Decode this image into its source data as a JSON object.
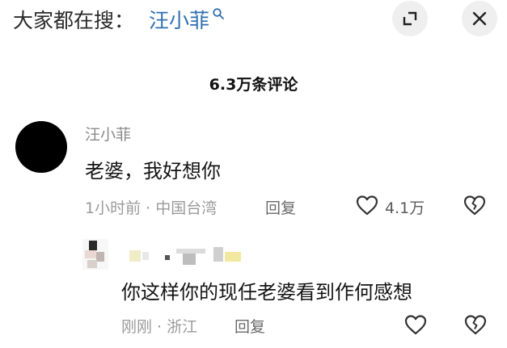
{
  "search": {
    "prefix": "大家都在搜：",
    "term": "汪小菲",
    "icon": "search-icon",
    "accent_color": "#2e6fb0"
  },
  "header": {
    "expand_icon": "expand-icon",
    "close_icon": "close-icon"
  },
  "comments_header": {
    "count_text": "6.3万条评论"
  },
  "comment": {
    "username": "汪小菲",
    "text": "老婆，我好想你",
    "meta": "1小时前 · 中国台湾",
    "reply_label": "回复",
    "like_count": "4.1万",
    "like_icon": "heart-icon",
    "dislike_icon": "broken-heart-icon"
  },
  "reply_comment": {
    "text": "你这样你的现任老婆看到作何感想",
    "meta": "刚刚 · 浙江",
    "reply_label": "回复",
    "like_icon": "heart-icon",
    "dislike_icon": "broken-heart-icon"
  }
}
